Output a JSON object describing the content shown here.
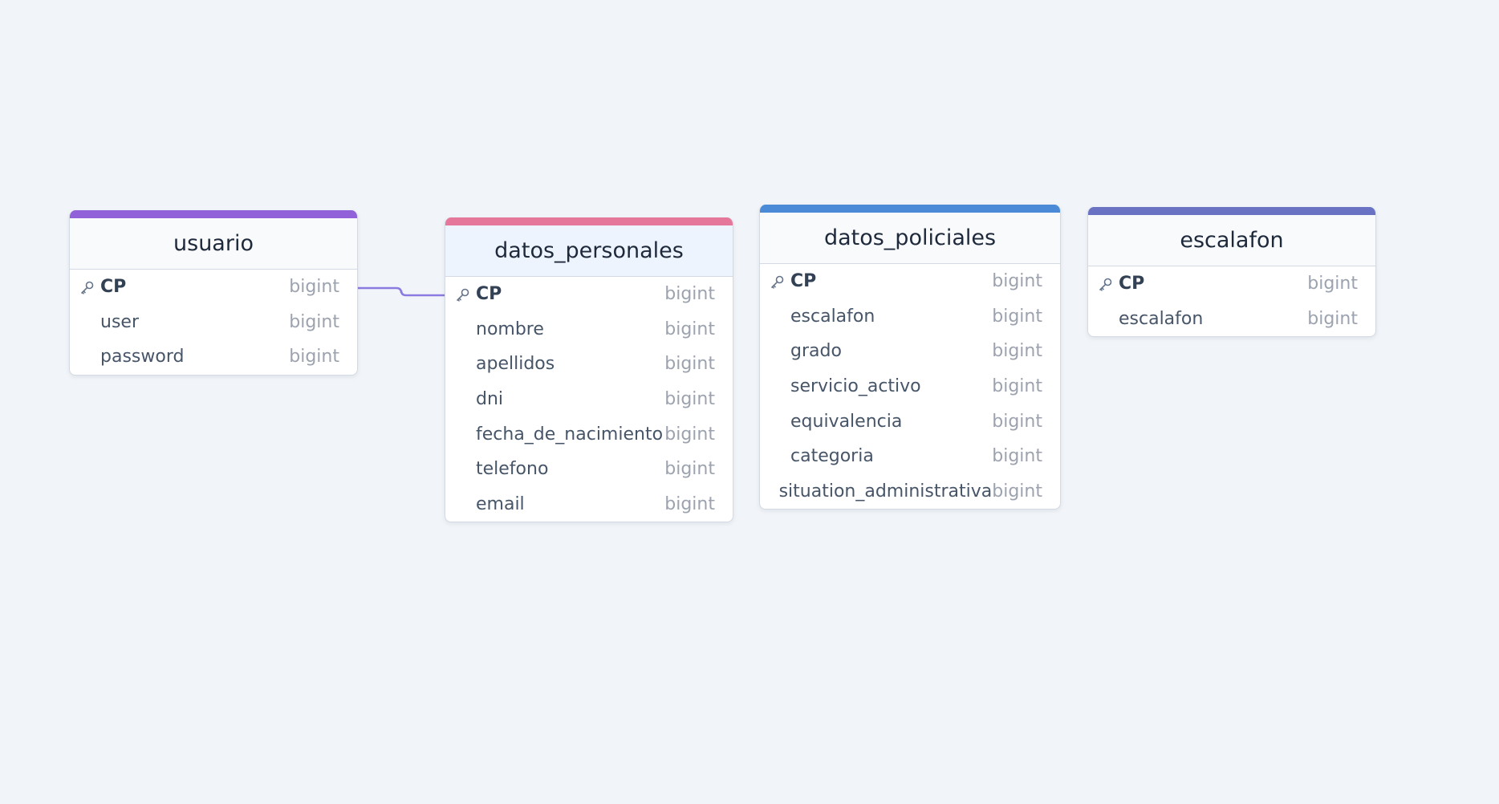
{
  "colors": {
    "background": "#f1f5f9",
    "relation_line": "#8b7ae0",
    "usuario": "#9061d8",
    "datos_personales": "#e5779a",
    "datos_policiales": "#4a8ad6",
    "escalafon": "#6a72c4"
  },
  "tables": [
    {
      "name": "usuario",
      "color": "#9061d8",
      "fields": [
        {
          "name": "CP",
          "type": "bigint",
          "pk": true
        },
        {
          "name": "user",
          "type": "bigint"
        },
        {
          "name": "password",
          "type": "bigint"
        }
      ]
    },
    {
      "name": "datos_personales",
      "color": "#e5779a",
      "selected": true,
      "fields": [
        {
          "name": "CP",
          "type": "bigint",
          "pk": true
        },
        {
          "name": "nombre",
          "type": "bigint"
        },
        {
          "name": "apellidos",
          "type": "bigint"
        },
        {
          "name": "dni",
          "type": "bigint"
        },
        {
          "name": "fecha_de_nacimiento",
          "type": "bigint"
        },
        {
          "name": "telefono",
          "type": "bigint"
        },
        {
          "name": "email",
          "type": "bigint"
        }
      ]
    },
    {
      "name": "datos_policiales",
      "color": "#4a8ad6",
      "fields": [
        {
          "name": "CP",
          "type": "bigint",
          "pk": true
        },
        {
          "name": "escalafon",
          "type": "bigint"
        },
        {
          "name": "grado",
          "type": "bigint"
        },
        {
          "name": "servicio_activo",
          "type": "bigint"
        },
        {
          "name": "equivalencia",
          "type": "bigint"
        },
        {
          "name": "categoria",
          "type": "bigint"
        },
        {
          "name": "situation_administrativa",
          "type": "bigint"
        }
      ]
    },
    {
      "name": "escalafon",
      "color": "#6a72c4",
      "fields": [
        {
          "name": "CP",
          "type": "bigint",
          "pk": true
        },
        {
          "name": "escalafon",
          "type": "bigint"
        }
      ]
    }
  ],
  "relations": [
    {
      "from": "usuario.CP",
      "to": "datos_personales.CP"
    }
  ]
}
